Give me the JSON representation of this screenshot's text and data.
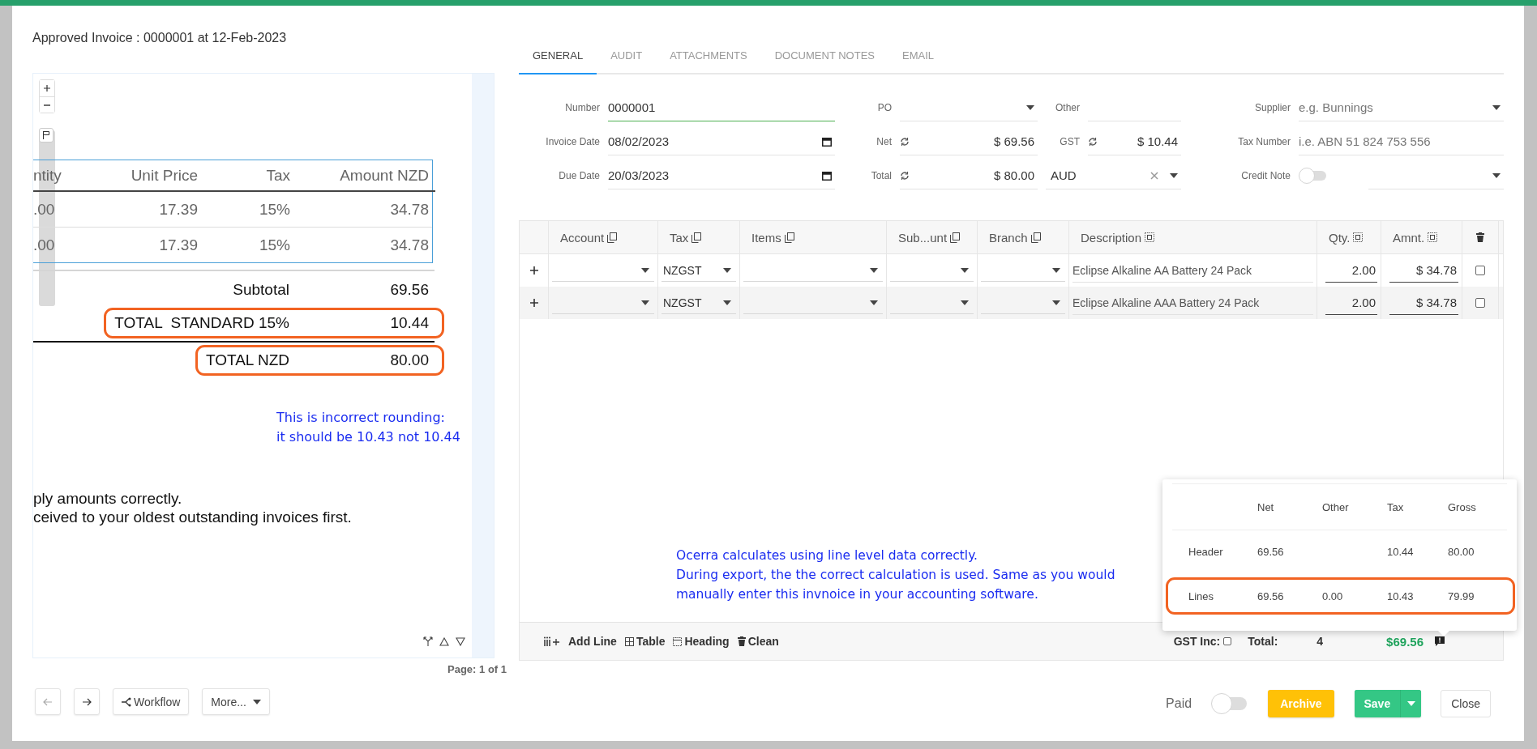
{
  "dialog": {
    "title": "Approved Invoice : 0000001 at 12-Feb-2023"
  },
  "document": {
    "columns": [
      "ntity",
      "Unit Price",
      "Tax",
      "Amount NZD"
    ],
    "rows": [
      [
        ".00",
        "17.39",
        "15%",
        "34.78"
      ],
      [
        ".00",
        "17.39",
        "15%",
        "34.78"
      ]
    ],
    "totals": [
      {
        "kind": "subtotal",
        "label": "Subtotal",
        "value": "69.56",
        "highlighted": false
      },
      {
        "kind": "tax",
        "label": "TOTAL  STANDARD 15%",
        "value": "10.44",
        "highlighted": true
      },
      {
        "kind": "grand",
        "label": "TOTAL NZD",
        "value": "80.00",
        "highlighted": true
      }
    ],
    "comment": [
      "This is incorrect rounding:",
      "it should be 10.43 not 10.44"
    ],
    "body_lines": [
      "ply amounts correctly.",
      "ceived to your oldest outstanding invoices first."
    ],
    "page_label": "Page: 1 of 1"
  },
  "nav": [
    {
      "kind": "prev",
      "disabled": true
    },
    {
      "kind": "next",
      "disabled": false
    },
    {
      "kind": "workflow",
      "label": "Workflow"
    },
    {
      "kind": "more",
      "label": "More..."
    }
  ],
  "tabs": [
    {
      "label": "GENERAL",
      "selected": true
    },
    {
      "label": "AUDIT",
      "selected": false
    },
    {
      "label": "ATTACHMENTS",
      "selected": false
    },
    {
      "label": "DOCUMENT NOTES",
      "selected": false
    },
    {
      "label": "EMAIL",
      "selected": false
    }
  ],
  "form": {
    "rows": [
      [
        {
          "label": "Number",
          "kind": "text",
          "value": "0000001",
          "focused": true
        },
        {
          "label": "PO",
          "kind": "select"
        },
        {
          "label": "Other",
          "kind": "text",
          "focused": false
        },
        {
          "label": "Supplier",
          "kind": "select",
          "placeholder": "e.g. Bunnings"
        }
      ],
      [
        {
          "label": "Invoice Date",
          "kind": "date",
          "value": "08/02/2023"
        },
        {
          "label": "Net",
          "kind": "amount",
          "value": "$ 69.56"
        },
        {
          "label": "GST",
          "kind": "amount",
          "value": "$ 10.44"
        },
        {
          "label": "Tax Number",
          "kind": "text",
          "placeholder": "i.e. ABN 51 824 753 556",
          "focused": false
        }
      ],
      [
        {
          "label": "Due Date",
          "kind": "date",
          "value": "20/03/2023"
        },
        {
          "label": "Total",
          "kind": "amount",
          "value": "$ 80.00"
        },
        {
          "kind": "currency",
          "value": "AUD"
        },
        {
          "label": "Credit Note",
          "kind": "toggle_select",
          "on": false
        }
      ]
    ]
  },
  "lines": {
    "columns": [
      {
        "kind": "add"
      },
      {
        "kind": "copy",
        "label": "Account"
      },
      {
        "kind": "copy",
        "label": "Tax"
      },
      {
        "kind": "copy",
        "label": "Items"
      },
      {
        "kind": "copy",
        "label": "Sub...unt"
      },
      {
        "kind": "copy",
        "label": "Branch"
      },
      {
        "kind": "fill",
        "label": "Description"
      },
      {
        "kind": "fill",
        "label": "Qty."
      },
      {
        "kind": "fill",
        "label": "Amnt."
      },
      {
        "kind": "delete"
      }
    ],
    "rows": [
      {
        "tax": "NZGST",
        "description": "Eclipse Alkaline AA Battery 24 Pack",
        "qty": "2.00",
        "amount": "$ 34.78",
        "checked": false
      },
      {
        "tax": "NZGST",
        "description": "Eclipse Alkaline AAA Battery 24 Pack",
        "qty": "2.00",
        "amount": "$ 34.78",
        "checked": false
      }
    ],
    "note": [
      "Ocerra calculates using line level data correctly.",
      "During export, the the correct calculation is used. Same as you would",
      "manually enter this invnoice in your accounting software."
    ],
    "tools": [
      {
        "kind": "add_line",
        "label": "Add Line"
      },
      {
        "kind": "table",
        "label": "Table"
      },
      {
        "kind": "heading",
        "label": "Heading"
      },
      {
        "kind": "clean",
        "label": "Clean"
      }
    ],
    "gst_inc": {
      "label": "GST Inc:",
      "checked": false
    },
    "total_label": "Total:",
    "count": "4",
    "total": "$69.56"
  },
  "popover": {
    "columns": [
      "Net",
      "Other",
      "Tax",
      "Gross"
    ],
    "rows": [
      {
        "label": "Header",
        "net": "69.56",
        "tax": "10.44",
        "gross": "80.00",
        "highlighted": false
      },
      {
        "label": "Lines",
        "net": "69.56",
        "other": "0.00",
        "tax": "10.43",
        "gross": "79.99",
        "highlighted": true
      }
    ]
  },
  "actions": {
    "paid": {
      "label": "Paid",
      "on": false
    },
    "buttons": [
      {
        "kind": "archive",
        "label": "Archive"
      },
      {
        "kind": "save",
        "label": "Save"
      },
      {
        "kind": "close",
        "label": "Close"
      }
    ]
  }
}
